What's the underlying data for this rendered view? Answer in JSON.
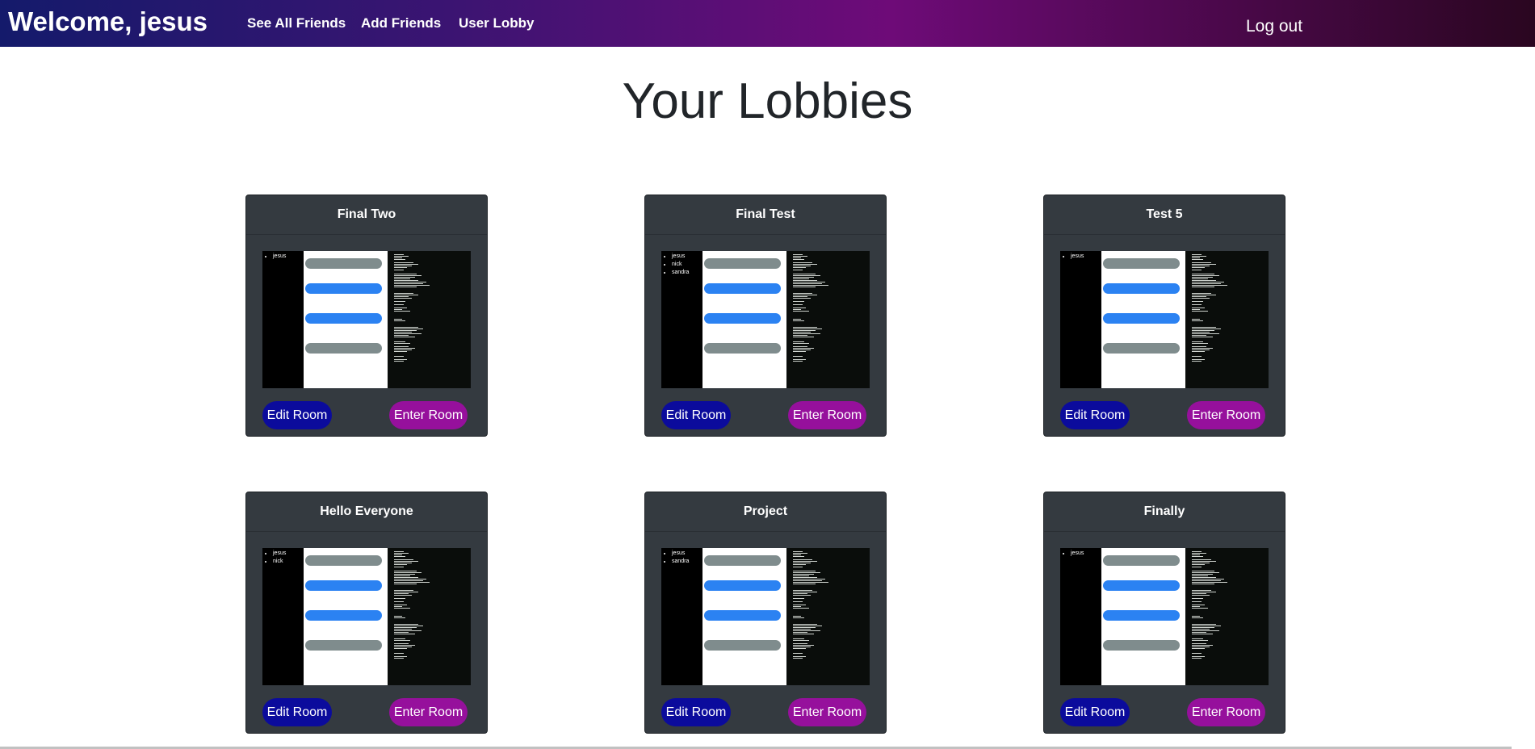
{
  "navbar": {
    "brand": "Welcome, jesus",
    "links": [
      "See All Friends",
      "Add Friends",
      "User Lobby"
    ],
    "logout": "Log out"
  },
  "page": {
    "title": "Your Lobbies"
  },
  "lobbies": [
    {
      "name": "Final Two",
      "users": [
        "jesus"
      ]
    },
    {
      "name": "Final Test",
      "users": [
        "jesus",
        "nick",
        "sandra"
      ]
    },
    {
      "name": "Test 5",
      "users": [
        "jesus"
      ]
    },
    {
      "name": "Hello Everyone",
      "users": [
        "jesus",
        "nick"
      ]
    },
    {
      "name": "Project",
      "users": [
        "jesus",
        "sandra"
      ]
    },
    {
      "name": "Finally",
      "users": [
        "jesus"
      ]
    }
  ],
  "buttons": {
    "edit": "Edit Room",
    "enter": "Enter Room"
  },
  "colors": {
    "edit_button": "#0b0b9c",
    "enter_button": "#96109c",
    "card_bg": "#343a40",
    "bubble_gray": "#7f8c8d",
    "bubble_blue": "#2b82f2"
  }
}
